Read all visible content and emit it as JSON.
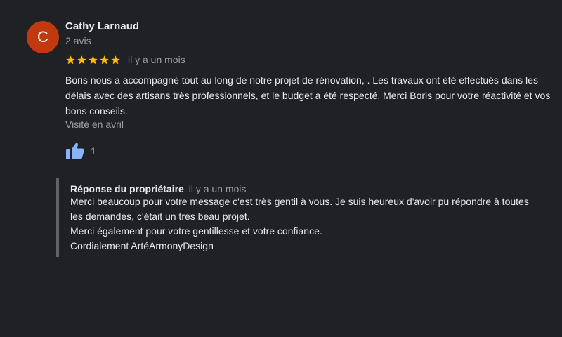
{
  "review": {
    "author": {
      "initial": "C",
      "name": "Cathy Larnaud",
      "meta": "2 avis",
      "avatar_color": "#c0390f"
    },
    "rating": {
      "stars": 5,
      "max": 5,
      "star_color": "#fbbc04"
    },
    "date": "il y a un mois",
    "text": "Boris nous a accompagné tout au long de notre projet de rénovation, . Les travaux ont été effectués dans les délais avec des artisans très professionnels, et le budget a été respecté. Merci Boris pour votre réactivité et vos bons conseils.",
    "visited": "Visité en avril",
    "likes": {
      "count": "1",
      "icon": "thumbs-up-icon",
      "icon_color": "#8ab4f8"
    }
  },
  "owner_reply": {
    "title": "Réponse du propriétaire",
    "date": "il y a un mois",
    "lines": [
      "Merci beaucoup pour votre message c'est très gentil à vous. Je suis heureux d'avoir pu répondre à toutes les demandes, c'était un très beau projet.",
      "Merci également pour votre gentillesse et votre confiance.",
      "Cordialement ArtéArmonyDesign"
    ]
  }
}
